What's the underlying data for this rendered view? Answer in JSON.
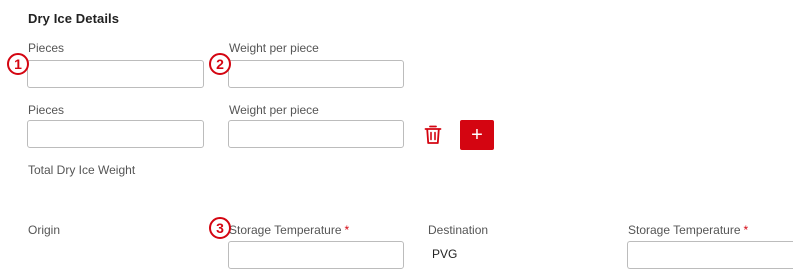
{
  "section": {
    "title": "Dry Ice Details"
  },
  "rows": [
    {
      "pieces_label": "Pieces",
      "pieces_value": "",
      "weight_label": "Weight per piece",
      "weight_value": ""
    },
    {
      "pieces_label": "Pieces",
      "pieces_value": "",
      "weight_label": "Weight per piece",
      "weight_value": ""
    }
  ],
  "markers": {
    "m1": "1",
    "m2": "2",
    "m3": "3"
  },
  "actions": {
    "add_label": "+",
    "delete_icon": "trash-icon"
  },
  "total": {
    "label": "Total Dry Ice Weight",
    "value": ""
  },
  "origin": {
    "label": "Origin",
    "storage_label": "Storage Temperature",
    "required_mark": "*",
    "storage_value": ""
  },
  "destination": {
    "label": "Destination",
    "value": "PVG",
    "storage_label": "Storage Temperature",
    "required_mark": "*",
    "storage_value": ""
  },
  "colors": {
    "accent": "#d40511",
    "border": "#bcbcbc"
  }
}
